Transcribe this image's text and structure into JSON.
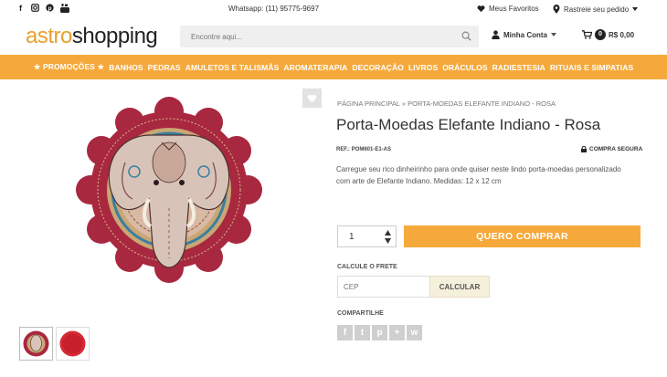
{
  "topbar": {
    "social_icons": [
      "facebook-icon",
      "instagram-icon",
      "pinterest-icon",
      "youtube-icon"
    ],
    "whatsapp": "Whatsapp: (11) 95775-9697",
    "favorites": "Meus Favoritos",
    "track_order": "Rastreie seu pedido"
  },
  "header": {
    "logo_part1": "astro",
    "logo_part2": "shopping",
    "search_placeholder": "Encontre aqui...",
    "account": "Minha Conta",
    "cart_count": "0",
    "cart_total": "R$ 0,00"
  },
  "nav": {
    "items": [
      "★ PROMOÇÕES ★",
      "BANHOS",
      "PEDRAS",
      "AMULETOS E TALISMÃS",
      "AROMATERAPIA",
      "DECORAÇÃO",
      "LIVROS",
      "ORÁCULOS",
      "RADIESTESIA",
      "RITUAIS E SIMPATIAS"
    ]
  },
  "product": {
    "breadcrumb_home": "PÁGINA PRINCIPAL",
    "breadcrumb_sep": "»",
    "breadcrumb_current": "PORTA-MOEDAS ELEFANTE INDIANO - ROSA",
    "title": "Porta-Moedas Elefante Indiano - Rosa",
    "ref": "REF.: POM601-E1-AS",
    "secure": "COMPRA SEGURA",
    "description": "Carregue seu rico dinheirinho para onde quiser neste lindo porta-moedas personalizado com arte de Elefante Indiano. Medidas: 12 x 12 cm",
    "quantity": "1",
    "buy_label": "QUERO COMPRAR",
    "shipping_label": "CALCULE O FRETE",
    "cep_placeholder": "CEP",
    "calc_label": "CALCULAR",
    "share_label": "COMPARTILHE",
    "share_icons": [
      "f",
      "t",
      "p",
      "+",
      "w"
    ]
  },
  "colors": {
    "accent": "#f6a93b",
    "text": "#333333",
    "product_red": "#b02a45"
  }
}
